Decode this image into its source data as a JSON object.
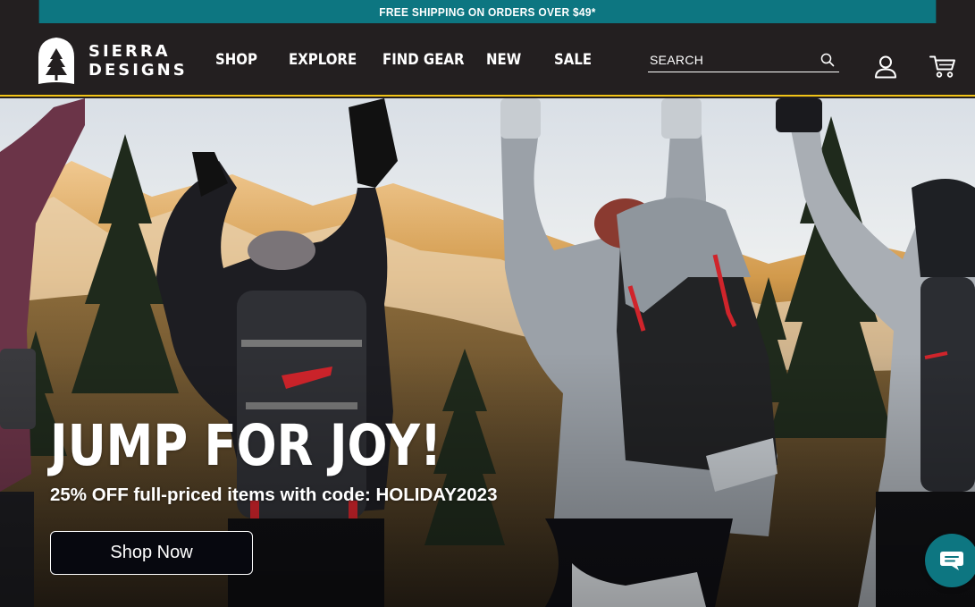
{
  "promo": {
    "text": "FREE SHIPPING ON ORDERS OVER $49*"
  },
  "header": {
    "logo_line1": "SIERRA",
    "logo_line2": "DESIGNS",
    "nav": [
      {
        "label": "SHOP"
      },
      {
        "label": "EXPLORE"
      },
      {
        "label": "FIND GEAR"
      },
      {
        "label": "NEW"
      },
      {
        "label": "SALE"
      }
    ],
    "search": {
      "placeholder": "SEARCH",
      "value": ""
    },
    "icons": {
      "search": "search-icon",
      "account": "user-icon",
      "cart": "cart-icon",
      "chat": "chat-icon"
    }
  },
  "hero": {
    "title": "JUMP FOR JOY!",
    "subtitle": "25% OFF full-priced items with code: HOLIDAY2023",
    "cta": "Shop Now"
  },
  "colors": {
    "promo_bg": "#0d7681",
    "header_bg": "#231f20",
    "accent_line": "#f2c417",
    "cta_bg": "#07080f",
    "chat_bg": "#0d7681"
  }
}
